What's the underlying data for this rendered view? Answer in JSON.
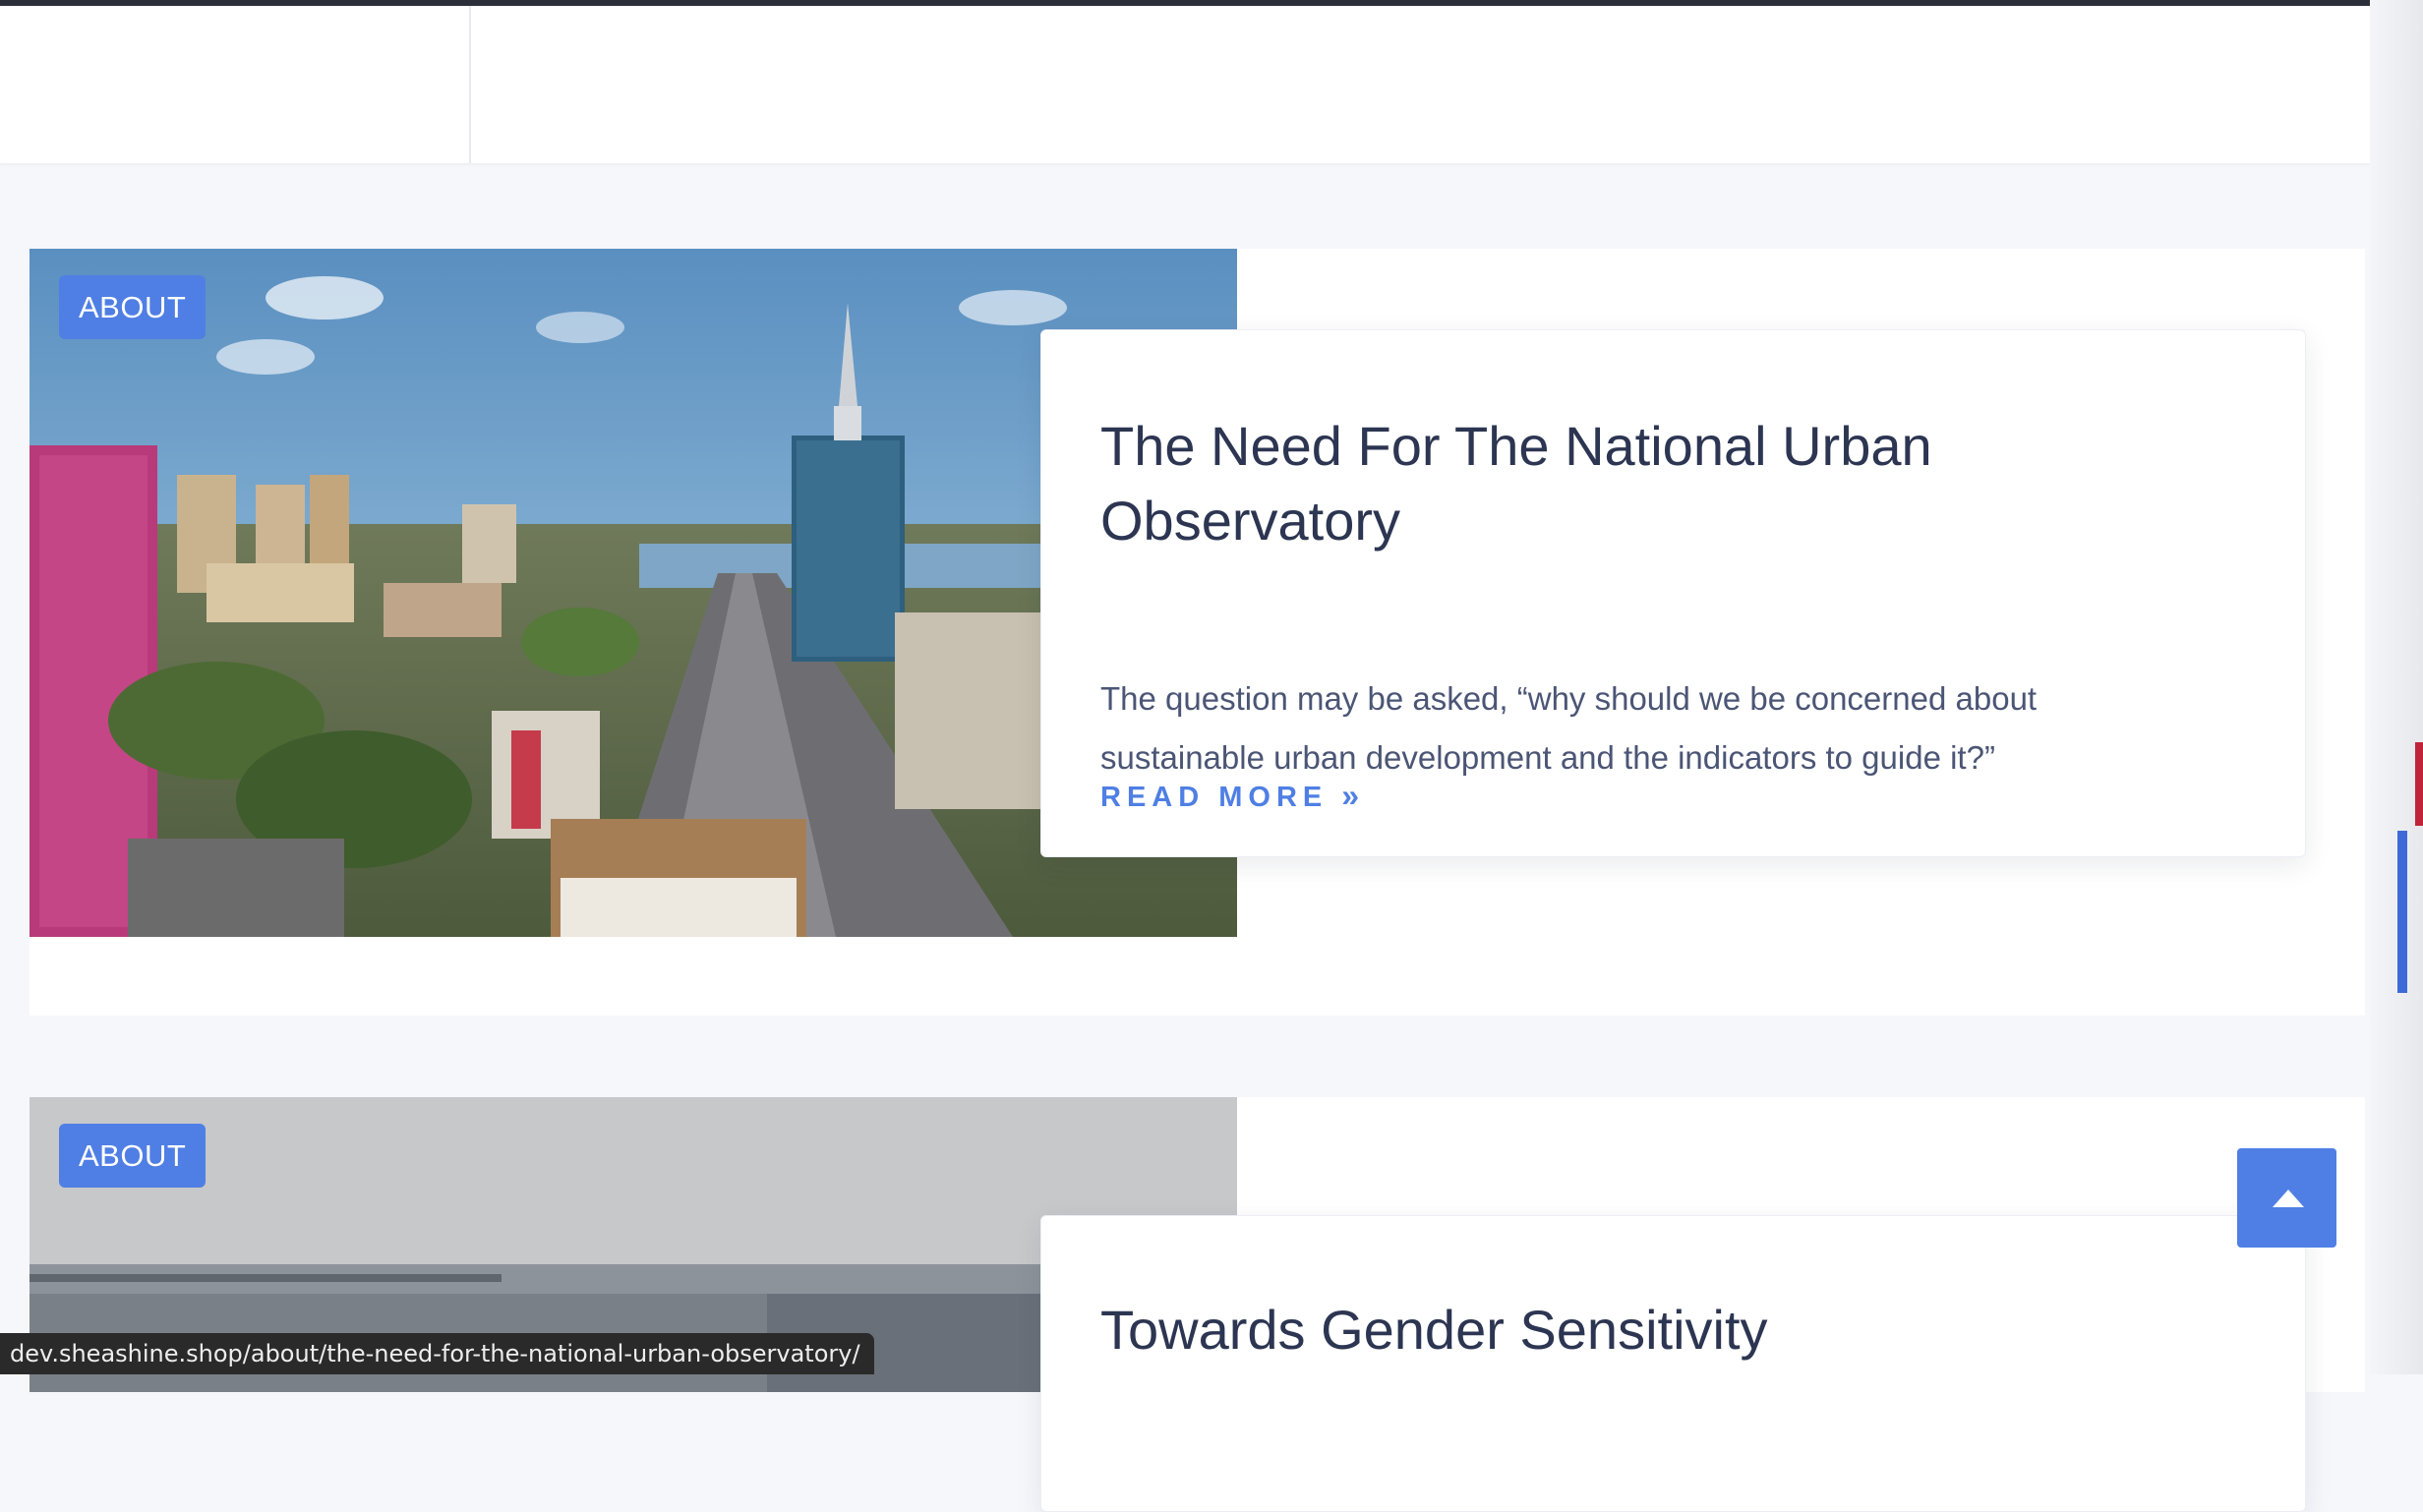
{
  "posts": [
    {
      "category": "ABOUT",
      "title": "The Need For The National Urban Observatory",
      "excerpt": "The question may be asked, “why should we be concerned about sustainable urban development and the indicators to guide it?”",
      "read_more": "READ MORE",
      "read_more_icon": "»"
    },
    {
      "category": "ABOUT",
      "title": "Towards Gender Sensitivity"
    }
  ],
  "back_to_top_icon": "arrow-up-icon",
  "status_url": "dev.sheashine.shop/about/the-need-for-the-national-urban-observatory/",
  "colors": {
    "accent": "#4f7fe4",
    "title": "#2c3551",
    "text": "#4b5575",
    "page_bg": "#f6f7fb"
  }
}
